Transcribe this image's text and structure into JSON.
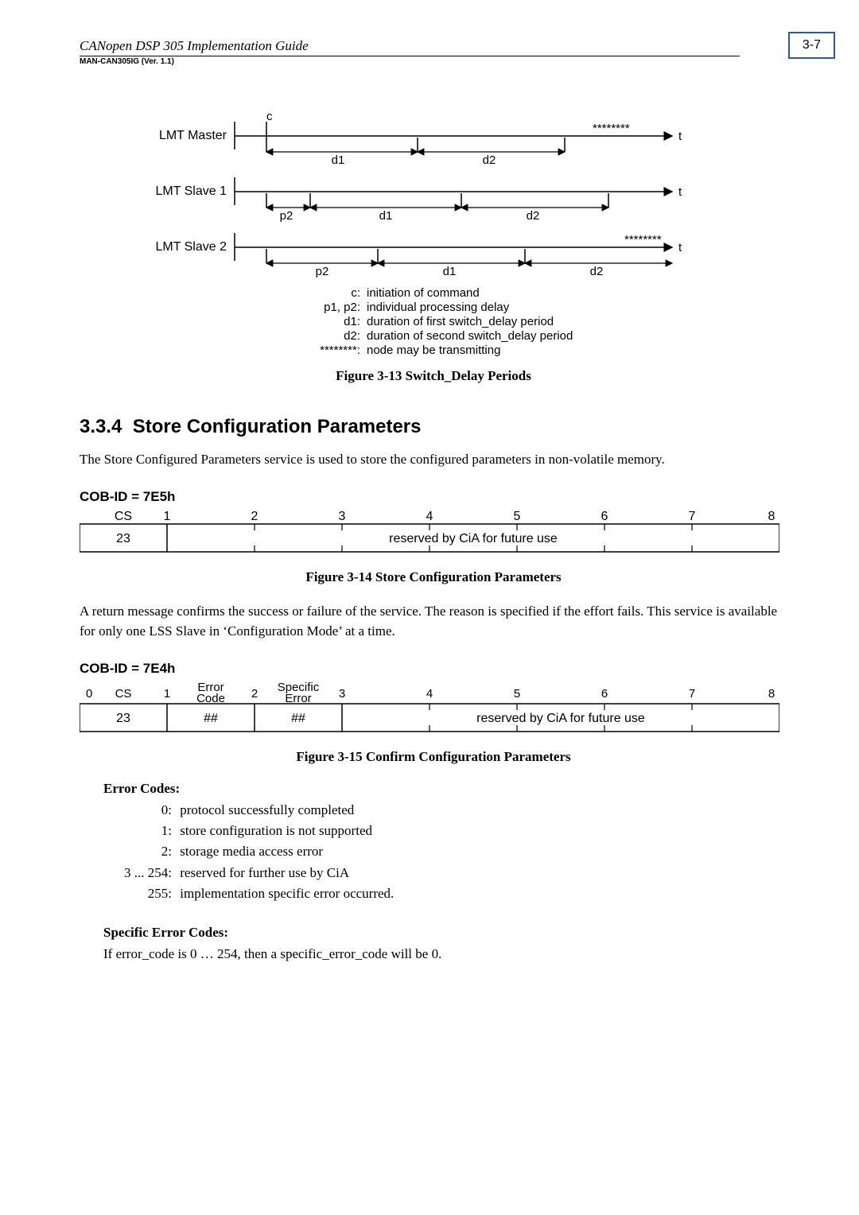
{
  "header": {
    "title": "CANopen DSP 305 Implementation Guide",
    "subtitle": "MAN-CAN305IG (Ver. 1.1)",
    "page_number": "3-7"
  },
  "diagram": {
    "rows": [
      "LMT Master",
      "LMT Slave 1",
      "LMT Slave 2"
    ],
    "labels": {
      "c": "c",
      "d1": "d1",
      "d2": "d2",
      "p2": "p2",
      "star": "********",
      "t": "t"
    },
    "legend": [
      {
        "key": "c:",
        "text": "initiation of command"
      },
      {
        "key": "p1, p2:",
        "text": "individual processing delay"
      },
      {
        "key": "d1:",
        "text": "duration of first switch_delay period"
      },
      {
        "key": "d2:",
        "text": "duration of second switch_delay period"
      },
      {
        "key": "********:",
        "text": "node may be transmitting"
      }
    ]
  },
  "fig13": "Figure 3-13  Switch_Delay Periods",
  "section": {
    "number": "3.3.4",
    "title": "Store Configuration Parameters"
  },
  "para1": "The Store Configured Parameters service is used to store the configured parameters in non-volatile memory.",
  "cob1": {
    "label": "COB-ID = 7E5h",
    "headers": [
      "CS",
      "1",
      "2",
      "3",
      "4",
      "5",
      "6",
      "7",
      "8"
    ],
    "cells": {
      "cs": "23",
      "rest": "reserved by CiA for future use"
    }
  },
  "fig14": "Figure 3-14  Store Configuration Parameters",
  "para2": "A return message confirms the success or failure of the service. The reason is specified if the effort fails. This service is available for only one LSS Slave in ‘Configuration Mode’ at a time.",
  "cob2": {
    "label": "COB-ID = 7E4h",
    "head_nums": [
      "0",
      "1",
      "2",
      "3",
      "4",
      "5",
      "6",
      "7",
      "8"
    ],
    "head_labels": {
      "cs": "CS",
      "err": "Error\nCode",
      "spec": "Specific\nError"
    },
    "cells": {
      "cs": "23",
      "err": "##",
      "spec": "##",
      "rest": "reserved by CiA for future use"
    }
  },
  "fig15": "Figure 3-15  Confirm Configuration Parameters",
  "error_codes": {
    "title": "Error Codes:",
    "items": [
      {
        "n": "0:",
        "t": "protocol successfully completed"
      },
      {
        "n": "1:",
        "t": "store configuration is not supported"
      },
      {
        "n": "2:",
        "t": "storage media access error"
      },
      {
        "n": "3 ... 254:",
        "t": "reserved for further use by CiA"
      },
      {
        "n": "255:",
        "t": "implementation specific error occurred."
      }
    ]
  },
  "specific_error": {
    "title": "Specific Error Codes:",
    "text": "If error_code is 0 … 254, then a specific_error_code will be 0."
  }
}
